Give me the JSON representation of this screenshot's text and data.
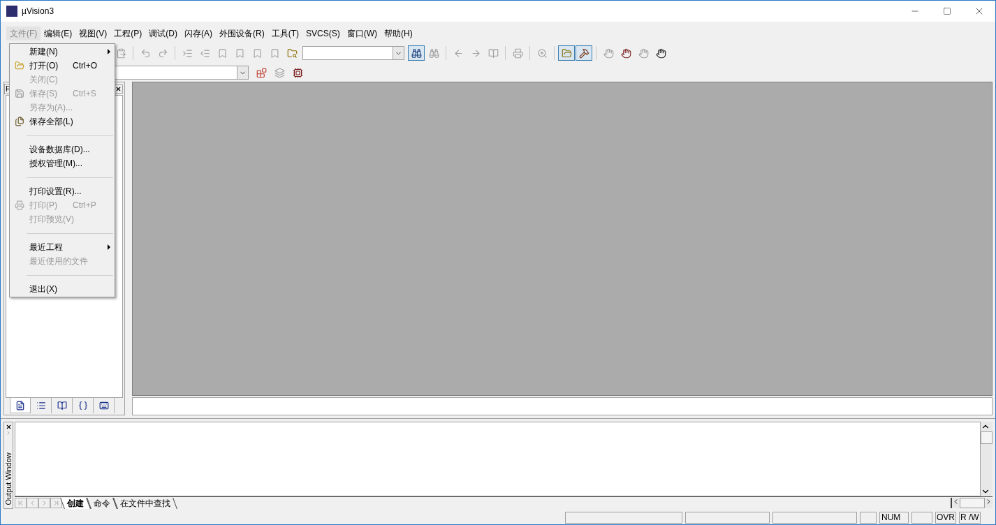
{
  "window": {
    "title": "µVision3"
  },
  "menu_bar": [
    {
      "label": "文件(F)",
      "selected": true
    },
    {
      "label": "编辑(E)",
      "selected": false
    },
    {
      "label": "视图(V)",
      "selected": false
    },
    {
      "label": "工程(P)",
      "selected": false
    },
    {
      "label": "调试(D)",
      "selected": false
    },
    {
      "label": "闪存(A)",
      "selected": false
    },
    {
      "label": "外围设备(R)",
      "selected": false
    },
    {
      "label": "工具(T)",
      "selected": false
    },
    {
      "label": "SVCS(S)",
      "selected": false
    },
    {
      "label": "窗口(W)",
      "selected": false
    },
    {
      "label": "帮助(H)",
      "selected": false
    }
  ],
  "file_menu": [
    {
      "kind": "item",
      "label": "新建(N)",
      "disabled": false,
      "submenu": true
    },
    {
      "kind": "item",
      "label": "打开(O)",
      "shortcut": "Ctrl+O",
      "disabled": false,
      "submenu": false
    },
    {
      "kind": "item",
      "label": "关闭(C)",
      "disabled": true,
      "submenu": false
    },
    {
      "kind": "item",
      "label": "保存(S)",
      "shortcut": "Ctrl+S",
      "disabled": true,
      "submenu": false
    },
    {
      "kind": "item",
      "label": "另存为(A)...",
      "disabled": true,
      "submenu": false
    },
    {
      "kind": "item",
      "label": "保存全部(L)",
      "disabled": false,
      "submenu": false
    },
    {
      "kind": "separator"
    },
    {
      "kind": "item",
      "label": "设备数据库(D)...",
      "disabled": false,
      "submenu": false
    },
    {
      "kind": "item",
      "label": "授权管理(M)...",
      "disabled": false,
      "submenu": false
    },
    {
      "kind": "separator"
    },
    {
      "kind": "item",
      "label": "打印设置(R)...",
      "disabled": false,
      "submenu": false
    },
    {
      "kind": "item",
      "label": "打印(P)",
      "shortcut": "Ctrl+P",
      "disabled": true,
      "submenu": false
    },
    {
      "kind": "item",
      "label": "打印预览(V)",
      "disabled": true,
      "submenu": false
    },
    {
      "kind": "separator"
    },
    {
      "kind": "item",
      "label": "最近工程",
      "disabled": false,
      "submenu": true
    },
    {
      "kind": "item",
      "label": "最近使用的文件",
      "disabled": true,
      "submenu": false
    },
    {
      "kind": "separator"
    },
    {
      "kind": "item",
      "label": "退出(X)",
      "disabled": false,
      "submenu": false
    }
  ],
  "project_panel": {
    "title": "F",
    "tabs": [
      {
        "selected": true
      },
      {
        "selected": false
      },
      {
        "selected": false
      },
      {
        "selected": false
      },
      {
        "selected": false
      }
    ]
  },
  "output_window": {
    "title": "Output Window",
    "tabs": [
      {
        "label": "创建",
        "selected": true
      },
      {
        "label": "命令",
        "selected": false
      },
      {
        "label": "在文件中查找",
        "selected": false
      }
    ]
  },
  "status_bar": {
    "num": "NUM",
    "ovr": "OVR",
    "rw": "R /W"
  }
}
